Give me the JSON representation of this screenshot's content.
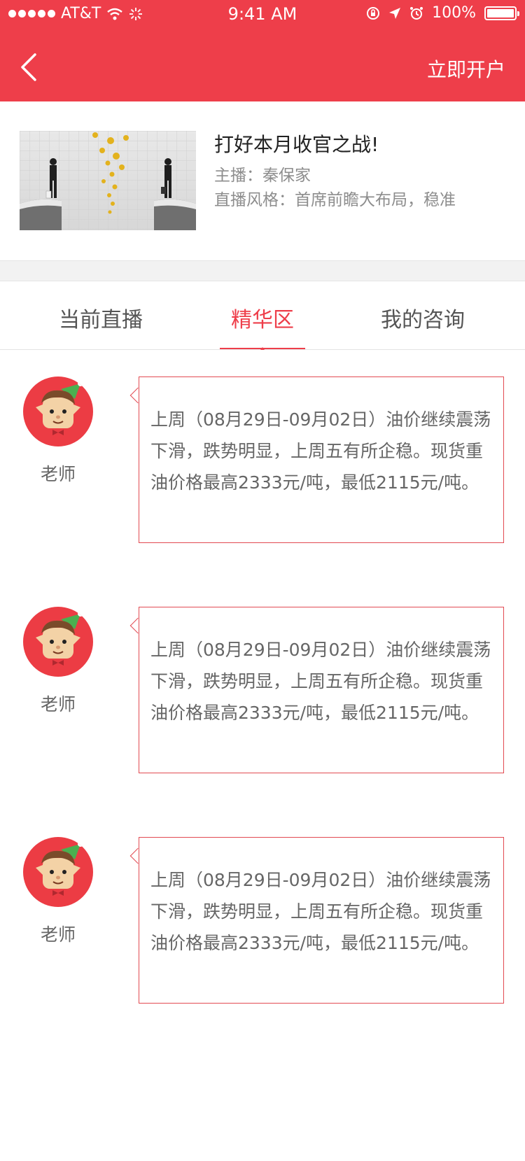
{
  "status_bar": {
    "carrier": "AT&T",
    "time": "9:41 AM",
    "battery": "100%"
  },
  "navbar": {
    "back_icon": "chevron-left-icon",
    "action_label": "立即开户"
  },
  "broadcast": {
    "title": "打好本月收官之战!",
    "host": "主播：秦保家",
    "style": "直播风格：首席前瞻大布局，稳准"
  },
  "tabs": [
    {
      "label": "当前直播",
      "active": false
    },
    {
      "label": "精华区",
      "active": true
    },
    {
      "label": "我的咨询",
      "active": false
    }
  ],
  "posts": [
    {
      "author": "老师",
      "text": "上周（08月29日-09月02日）油价继续震荡下滑，跌势明显，上周五有所企稳。现货重油价格最高2333元/吨，最低2115元/吨。"
    },
    {
      "author": "老师",
      "text": "上周（08月29日-09月02日）油价继续震荡下滑，跌势明显，上周五有所企稳。现货重油价格最高2333元/吨，最低2115元/吨。"
    },
    {
      "author": "老师",
      "text": "上周（08月29日-09月02日）油价继续震荡下滑，跌势明显，上周五有所企稳。现货重油价格最高2333元/吨，最低2115元/吨。"
    }
  ],
  "colors": {
    "brand": "#ee3e4a",
    "bubble_border": "#e24a52"
  }
}
